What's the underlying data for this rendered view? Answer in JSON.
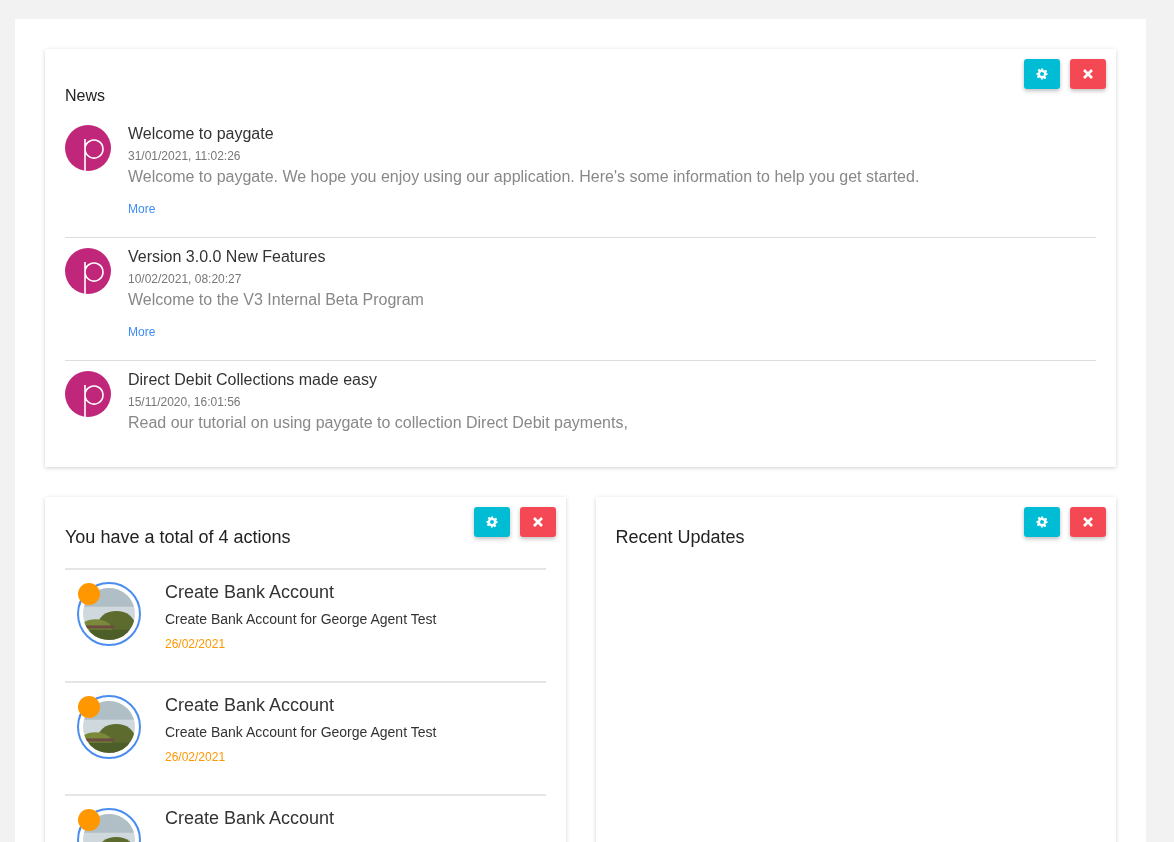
{
  "news": {
    "title": "News",
    "items": [
      {
        "title": "Welcome to paygate",
        "date": "31/01/2021, 11:02:26",
        "text": "Welcome to paygate. We hope you enjoy using our application. Here's some information to help you get started.",
        "more": "More"
      },
      {
        "title": "Version 3.0.0 New Features",
        "date": "10/02/2021, 08:20:27",
        "text": "Welcome to the V3 Internal Beta Program",
        "more": "More"
      },
      {
        "title": "Direct Debit Collections made easy",
        "date": "15/11/2020, 16:01:56",
        "text": "Read our tutorial on using paygate to collection Direct Debit payments,"
      }
    ]
  },
  "actions": {
    "title": "You have a total of 4 actions",
    "items": [
      {
        "title": "Create Bank Account",
        "description": "Create Bank Account for George Agent Test",
        "date": "26/02/2021"
      },
      {
        "title": "Create Bank Account",
        "description": "Create Bank Account for George Agent Test",
        "date": "26/02/2021"
      },
      {
        "title": "Create Bank Account"
      }
    ]
  },
  "updates": {
    "title": "Recent Updates"
  }
}
